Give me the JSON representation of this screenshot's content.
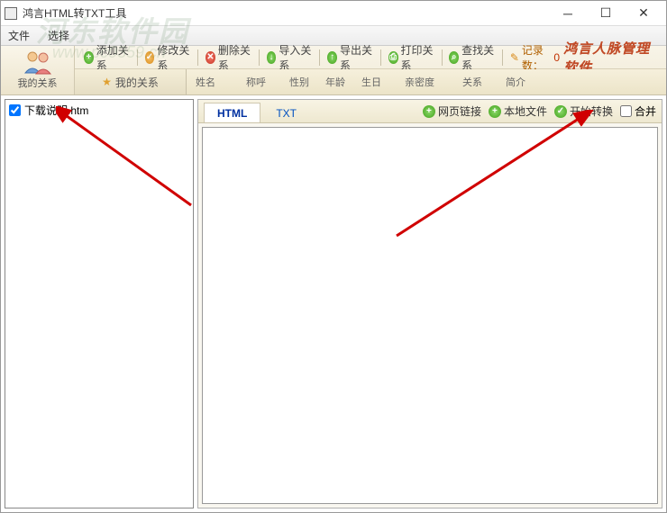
{
  "window": {
    "title": "鸿言HTML转TXT工具"
  },
  "menubar": {
    "file": "文件",
    "select": "选择"
  },
  "toolbar": {
    "left_label": "我的关系",
    "add": "添加关系",
    "edit": "修改关系",
    "delete": "删除关系",
    "import": "导入关系",
    "export": "导出关系",
    "print": "打印关系",
    "search": "查找关系",
    "record_label": "记录数：",
    "record_count": "0",
    "brand": "鸿言人脉管理软件",
    "myrel_tab": "我的关系"
  },
  "columns": {
    "name": "姓名",
    "salutation": "称呼",
    "gender": "性别",
    "age": "年龄",
    "birthday": "生日",
    "closeness": "亲密度",
    "relation": "关系",
    "intro": "简介"
  },
  "file_list": {
    "items": [
      {
        "checked": true,
        "label": "下载说明.htm"
      }
    ]
  },
  "right_panel": {
    "tabs": {
      "html": "HTML",
      "txt": "TXT"
    },
    "actions": {
      "web_link": "网页链接",
      "local_file": "本地文件",
      "start_convert": "开始转换",
      "merge": "合并"
    }
  },
  "watermark": {
    "text": "河东软件园",
    "url": "www.pc0359.cn"
  }
}
